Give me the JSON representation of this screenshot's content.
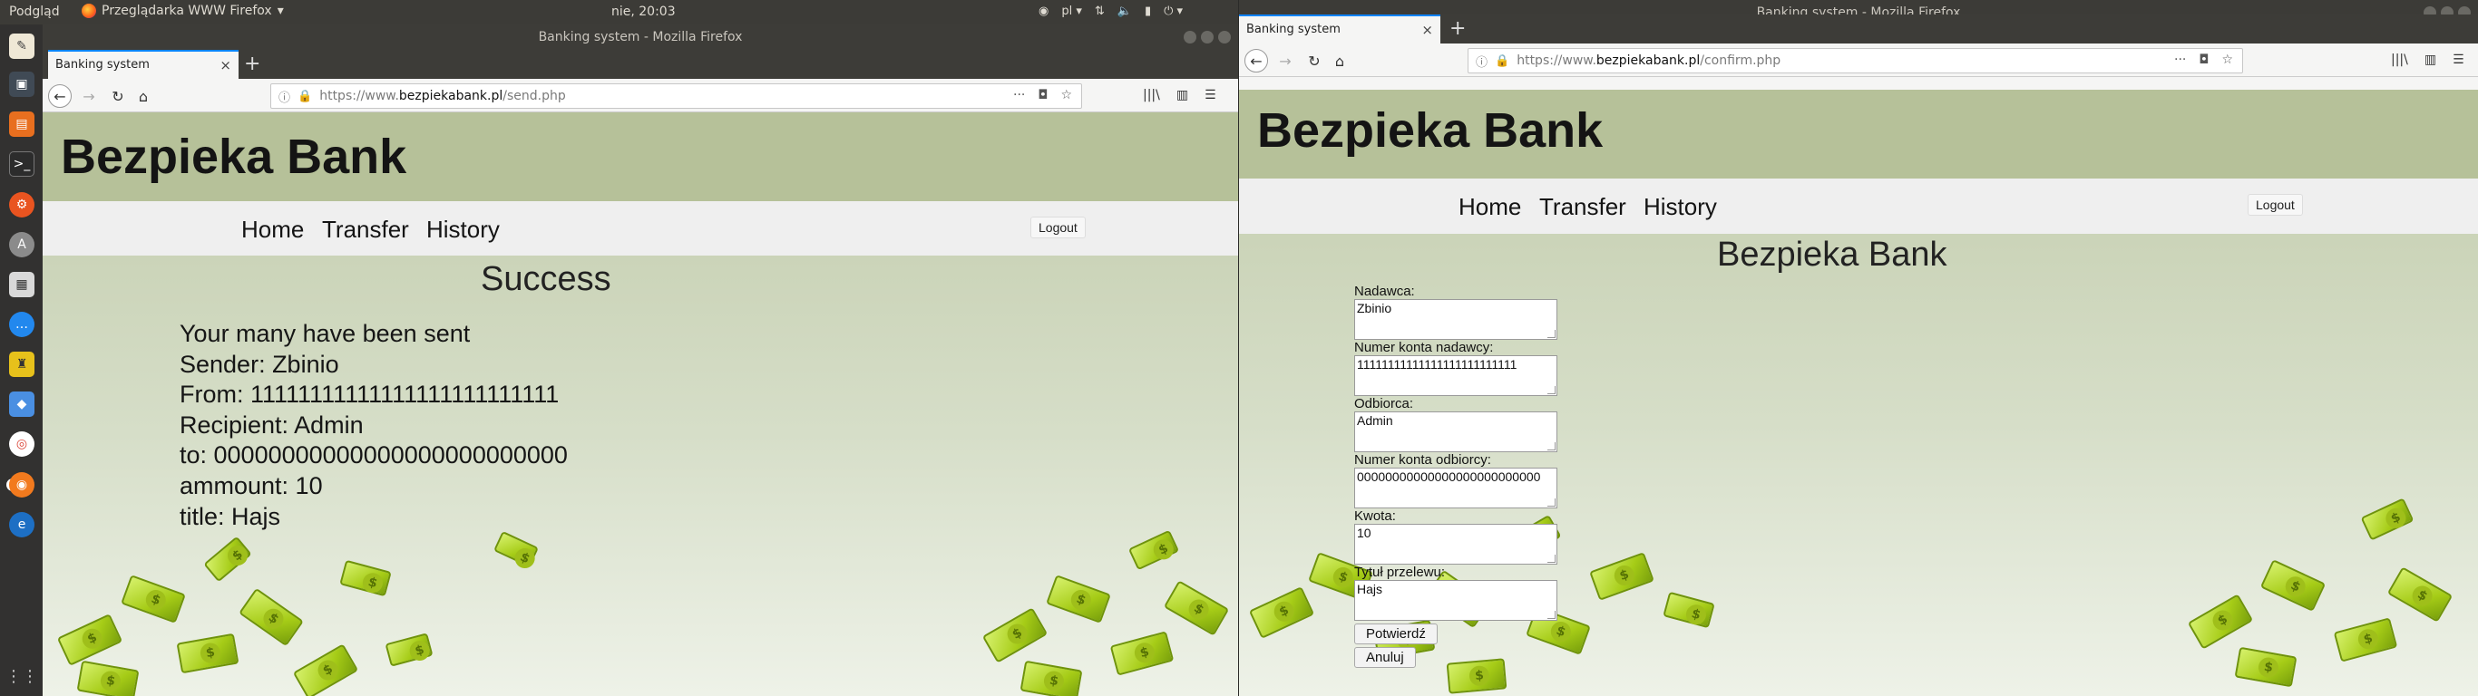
{
  "system": {
    "app_menu": "Podgląd",
    "firefox_menu": "Przeglądarka WWW Firefox",
    "clock": "nie, 20:03",
    "language": "pl"
  },
  "left_window": {
    "title": "Banking system - Mozilla Firefox",
    "tab_title": "Banking system",
    "url_prefix": "https://www.",
    "url_host": "bezpiekabank.pl",
    "url_path": "/send.php",
    "brand": "Bezpieka Bank",
    "nav": {
      "home": "Home",
      "transfer": "Transfer",
      "history": "History",
      "logout": "Logout"
    },
    "heading": "Success",
    "result_lines": [
      "Your many have been sent",
      "Sender: Zbinio",
      "From: 11111111111111111111111111",
      "Recipient: Admin",
      "to: 00000000000000000000000000",
      "ammount: 10",
      "title: Hajs"
    ]
  },
  "right_window": {
    "title": "Banking system - Mozilla Firefox",
    "tab_title": "Banking system",
    "url_prefix": "https://www.",
    "url_host": "bezpiekabank.pl",
    "url_path": "/confirm.php",
    "brand": "Bezpieka Bank",
    "nav": {
      "home": "Home",
      "transfer": "Transfer",
      "history": "History",
      "logout": "Logout"
    },
    "heading": "Bezpieka Bank",
    "form": {
      "sender_label": "Nadawca:",
      "sender_value": "Zbinio",
      "sender_account_label": "Numer konta nadawcy:",
      "sender_account_value": "11111111111111111111111111",
      "recipient_label": "Odbiorca:",
      "recipient_value": "Admin",
      "recipient_account_label": "Numer konta odbiorcy:",
      "recipient_account_value": "00000000000000000000000000",
      "amount_label": "Kwota:",
      "amount_value": "10",
      "title_label": "Tytuł przelewu:",
      "title_value": "Hajs",
      "confirm_label": "Potwierdź",
      "cancel_label": "Anuluj"
    }
  }
}
